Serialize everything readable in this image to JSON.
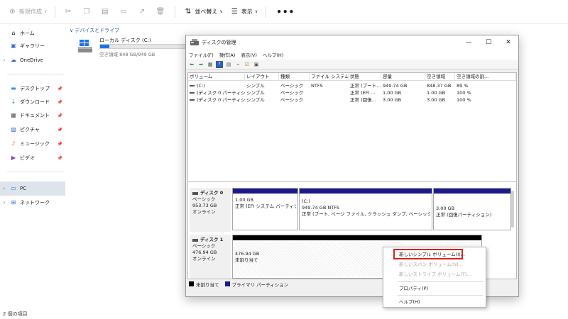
{
  "toolbar": {
    "new_label": "新規作成",
    "sort_label": "並べ替え",
    "view_label": "表示",
    "more_label": "•••"
  },
  "sidebar": {
    "items": [
      {
        "label": "ホーム",
        "icon": "home-icon"
      },
      {
        "label": "ギャラリー",
        "icon": "gallery-icon"
      },
      {
        "label": "OneDrive",
        "icon": "cloud-icon"
      },
      {
        "label": "デスクトップ",
        "icon": "desktop-icon"
      },
      {
        "label": "ダウンロード",
        "icon": "download-icon"
      },
      {
        "label": "ドキュメント",
        "icon": "document-icon"
      },
      {
        "label": "ピクチャ",
        "icon": "picture-icon"
      },
      {
        "label": "ミュージック",
        "icon": "music-icon"
      },
      {
        "label": "ビデオ",
        "icon": "video-icon"
      },
      {
        "label": "PC",
        "icon": "pc-icon"
      },
      {
        "label": "ネットワーク",
        "icon": "network-icon"
      }
    ]
  },
  "main": {
    "section_title": "デバイスとドライブ",
    "drive": {
      "name": "ローカル ディスク (C:)",
      "free_text": "空き領域 848 GB/949 GB",
      "used_fraction": 0.107
    }
  },
  "status": {
    "item_count": "2 個の項目"
  },
  "disk_mgmt": {
    "title": "ディスクの管理",
    "window_buttons": {
      "minimize": "—",
      "maximize": "☐",
      "close": "✕"
    },
    "menu": [
      "ファイル(F)",
      "操作(A)",
      "表示(V)",
      "ヘルプ(H)"
    ],
    "table": {
      "columns": [
        "ボリューム",
        "レイアウト",
        "種類",
        "ファイル システム",
        "状態",
        "容量",
        "空き領域",
        "空き領域の割..."
      ],
      "rows": [
        [
          "(C:)",
          "シンプル",
          "ベーシック",
          "NTFS",
          "正常 (ブート...",
          "949.74 GB",
          "848.37 GB",
          "89 %"
        ],
        [
          "(ディスク 0 パーティショ...",
          "シンプル",
          "ベーシック",
          "",
          "正常 (EFI ...",
          "1.00 GB",
          "1.00 GB",
          "100 %"
        ],
        [
          "(ディスク 0 パーティショ...",
          "シンプル",
          "ベーシック",
          "",
          "正常 (回復...",
          "3.00 GB",
          "3.00 GB",
          "100 %"
        ]
      ]
    },
    "disks": [
      {
        "name": "ディスク 0",
        "type": "ベーシック",
        "size": "953.73 GB",
        "status": "オンライン",
        "partitions": [
          {
            "line1": "",
            "line2": "1.00 GB",
            "line3": "正常 (EFI システム パーティショ"
          },
          {
            "line1": "(C:)",
            "line2": "949.74 GB NTFS",
            "line3": "正常 (ブート, ページ ファイル, クラッシュ ダンプ, ベーシック データ パ"
          },
          {
            "line1": "",
            "line2": "3.00 GB",
            "line3": "正常 (回復パーティション)"
          }
        ]
      },
      {
        "name": "ディスク 1",
        "type": "ベーシック",
        "size": "476.94 GB",
        "status": "オンライン",
        "partitions": [
          {
            "line1": "476.94 GB",
            "line2": "未割り当て"
          }
        ]
      }
    ],
    "legend": [
      {
        "label": "未割り当て",
        "color": "#000000"
      },
      {
        "label": "プライマリ パーティション",
        "color": "#1a1a8c"
      }
    ]
  },
  "context_menu": {
    "items": [
      {
        "label": "新しいシンプル ボリューム(I)...",
        "enabled": true
      },
      {
        "label": "新しいスパン ボリューム(N)...",
        "enabled": false
      },
      {
        "label": "新しいストライプ ボリューム(T)...",
        "enabled": false
      },
      {
        "label": "プロパティ(P)",
        "enabled": true
      },
      {
        "label": "ヘルプ(H)",
        "enabled": true
      }
    ]
  },
  "colors": {
    "primary_partition": "#1a1a8c",
    "unallocated": "#000000",
    "highlight": "#e01e1e",
    "drive_bar": "#1a73e8"
  }
}
